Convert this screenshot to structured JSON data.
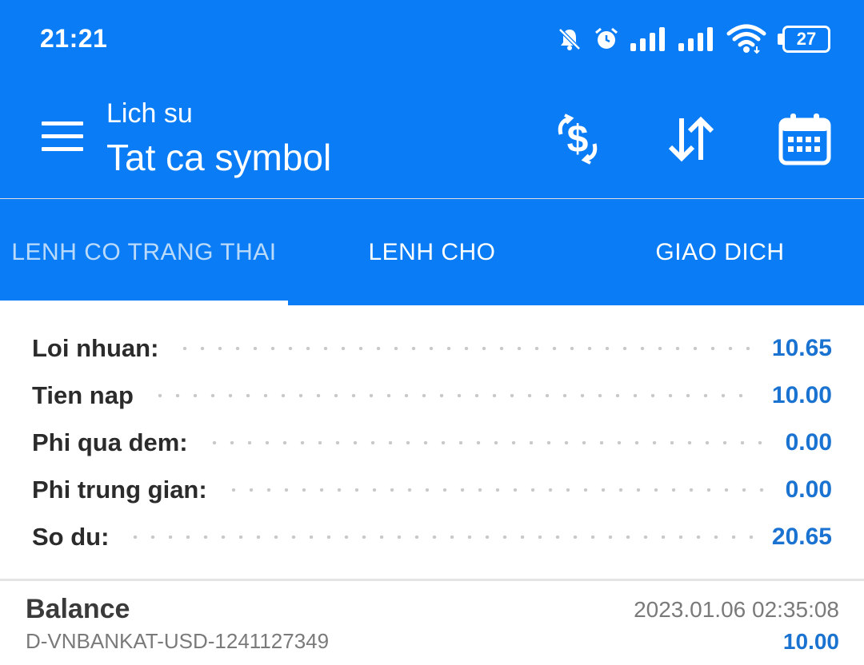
{
  "status_bar": {
    "time": "21:21",
    "battery_level": "27",
    "icons": [
      "bell-muted-icon",
      "alarm-icon",
      "signal-icon",
      "signal-icon",
      "wifi-icon",
      "battery-icon"
    ]
  },
  "app_bar": {
    "subtitle": "Lich su",
    "title": "Tat ca symbol",
    "actions": [
      "currency-exchange-icon",
      "sort-icon",
      "calendar-icon"
    ]
  },
  "tabs": [
    {
      "label": "LENH CO TRANG THAI",
      "selected": true
    },
    {
      "label": "LENH CHO",
      "selected": false
    },
    {
      "label": "GIAO DICH",
      "selected": false
    }
  ],
  "summary": [
    {
      "label": "Loi nhuan:",
      "value": "10.65"
    },
    {
      "label": "Tien nap",
      "value": "10.00"
    },
    {
      "label": "Phi qua dem:",
      "value": "0.00"
    },
    {
      "label": "Phi trung gian:",
      "value": "0.00"
    },
    {
      "label": "So du:",
      "value": "20.65"
    }
  ],
  "records": [
    {
      "type": "Balance",
      "datetime": "2023.01.06 02:35:08",
      "account": "D-VNBANKAT-USD-1241127349",
      "amount": "10.00"
    }
  ],
  "colors": {
    "primary": "#0a7cf5",
    "value_blue": "#1b73d1",
    "label": "#2b2b2b",
    "muted": "#7a7a7a"
  }
}
